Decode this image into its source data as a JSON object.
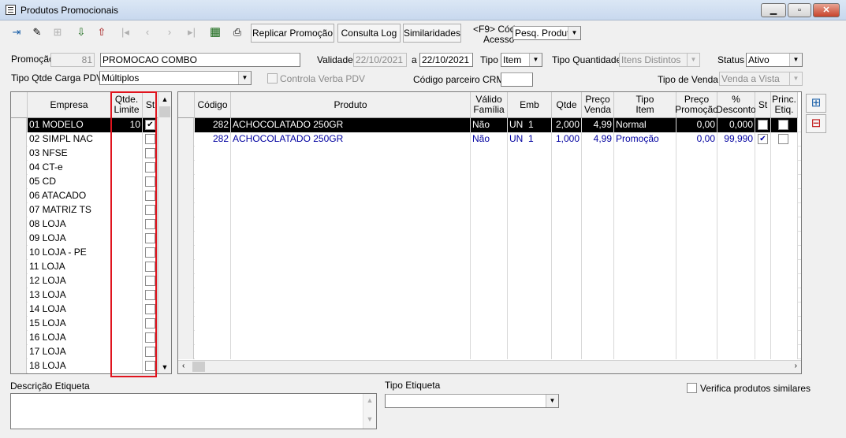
{
  "window": {
    "title": "Produtos Promocionais"
  },
  "toolbar": {
    "replicar": "Replicar Promoção",
    "consulta_log": "Consulta Log",
    "similaridades": "Similaridades",
    "cod_acesso_label1": "<F9> Cód",
    "cod_acesso_label2": "Acesso",
    "cod_acesso_value": "Pesq. Produto"
  },
  "form": {
    "promocao_label": "Promoção",
    "promocao_num": "81",
    "promocao_nome": "PROMOCAO COMBO",
    "validade_label": "Validade",
    "validade_de": "22/10/2021",
    "a_label": "a",
    "validade_ate": "22/10/2021",
    "tipo_label": "Tipo",
    "tipo_value": "Item",
    "tipo_qtde_label": "Tipo Quantidade",
    "tipo_qtde_value": "Itens Distintos",
    "status_label": "Status",
    "status_value": "Ativo",
    "carga_label": "Tipo Qtde Carga PDV",
    "carga_value": "Múltiplos",
    "controla_label": "Controla Verba PDV",
    "crm_label": "Código parceiro CRM",
    "crm_value": "",
    "tipo_venda_label": "Tipo de Venda",
    "tipo_venda_value": "Venda a Vista"
  },
  "empresa_grid": {
    "headers": {
      "empresa": "Empresa",
      "qtde": "Qtde. Limite",
      "st": "St"
    },
    "rows": [
      {
        "nome": "01 MODELO",
        "qtde": "10",
        "st": true
      },
      {
        "nome": "02 SIMPL NAC",
        "qtde": "",
        "st": false
      },
      {
        "nome": "03 NFSE",
        "qtde": "",
        "st": false
      },
      {
        "nome": "04 CT-e",
        "qtde": "",
        "st": false
      },
      {
        "nome": "05 CD",
        "qtde": "",
        "st": false
      },
      {
        "nome": "06 ATACADO",
        "qtde": "",
        "st": false
      },
      {
        "nome": "07 MATRIZ TS",
        "qtde": "",
        "st": false
      },
      {
        "nome": "08 LOJA",
        "qtde": "",
        "st": false
      },
      {
        "nome": "09 LOJA",
        "qtde": "",
        "st": false
      },
      {
        "nome": "10 LOJA - PE",
        "qtde": "",
        "st": false
      },
      {
        "nome": "11 LOJA",
        "qtde": "",
        "st": false
      },
      {
        "nome": "12 LOJA",
        "qtde": "",
        "st": false
      },
      {
        "nome": "13 LOJA",
        "qtde": "",
        "st": false
      },
      {
        "nome": "14 LOJA",
        "qtde": "",
        "st": false
      },
      {
        "nome": "15 LOJA",
        "qtde": "",
        "st": false
      },
      {
        "nome": "16 LOJA",
        "qtde": "",
        "st": false
      },
      {
        "nome": "17 LOJA",
        "qtde": "",
        "st": false
      },
      {
        "nome": "18 LOJA",
        "qtde": "",
        "st": false
      }
    ]
  },
  "produto_grid": {
    "headers": {
      "codigo": "Código",
      "produto": "Produto",
      "valido": "Válido Família",
      "emb": "Emb",
      "qtde": "Qtde",
      "preco_venda": "Preço Venda",
      "tipo_item": "Tipo Item",
      "preco_promo": "Preço Promoção",
      "desconto": "% Desconto",
      "st": "St",
      "princ": "Princ. Etiq."
    },
    "rows": [
      {
        "codigo": "282",
        "produto": "ACHOCOLATADO 250GR",
        "valido": "Não",
        "emb": "UN",
        "emb_qt": "1",
        "qtde": "2,000",
        "preco_venda": "4,99",
        "tipo_item": "Normal",
        "preco_promo": "0,00",
        "desconto": "0,000",
        "st": true,
        "princ": false
      },
      {
        "codigo": "282",
        "produto": "ACHOCOLATADO 250GR",
        "valido": "Não",
        "emb": "UN",
        "emb_qt": "1",
        "qtde": "1,000",
        "preco_venda": "4,99",
        "tipo_item": "Promoção",
        "preco_promo": "0,00",
        "desconto": "99,990",
        "st": true,
        "princ": false
      }
    ]
  },
  "bottom": {
    "descricao_label": "Descrição Etiqueta",
    "tipo_etiqueta_label": "Tipo Etiqueta",
    "verifica_label": "Verifica produtos similares"
  },
  "colors": {
    "selection": "#000000",
    "promo_text": "#0000a0",
    "highlight_box": "#e0141e"
  }
}
